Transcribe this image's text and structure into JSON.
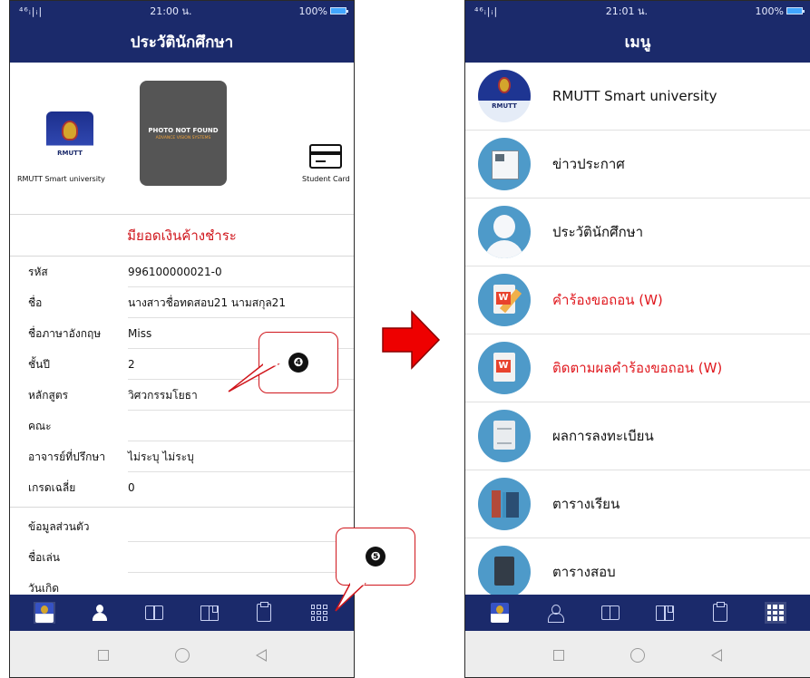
{
  "left": {
    "status": {
      "signal": "⁴⁶ᵢ|ᵢ|",
      "time": "21:00 น.",
      "battery": "100%"
    },
    "title": "ประวัตินักศึกษา",
    "app_caption": "RMUTT Smart university",
    "app_logo_text": "RMUTT",
    "photo_text": "PHOTO NOT FOUND",
    "photo_subtext": "ADVANCE VISION SYSTEMS",
    "card_caption": "Student Card",
    "debt_notice": "มียอดเงินค้างชำระ",
    "rows": [
      {
        "label": "รหัส",
        "value": "996100000021-0"
      },
      {
        "label": "ชื่อ",
        "value": "นางสาวชื่อทดสอบ21 นามสกุล21"
      },
      {
        "label": "ชื่อภาษาอังกฤษ",
        "value": "Miss"
      },
      {
        "label": "ชั้นปี",
        "value": "2"
      },
      {
        "label": "หลักสูตร",
        "value": "วิศวกรรมโยธา"
      },
      {
        "label": "คณะ",
        "value": ""
      },
      {
        "label": "อาจารย์ที่ปรึกษา",
        "value": "ไม่ระบุ ไม่ระบุ"
      },
      {
        "label": "เกรดเฉลี่ย",
        "value": "0"
      }
    ],
    "rows2": [
      {
        "label": "ข้อมูลส่วนตัว",
        "value": ""
      },
      {
        "label": "ชื่อเล่น",
        "value": ""
      },
      {
        "label": "วันเกิด",
        "value": ""
      }
    ]
  },
  "callouts": {
    "c4": "❹",
    "c5": "❺"
  },
  "right": {
    "status": {
      "signal": "⁴⁶ᵢ|ᵢ|",
      "time": "21:01 น.",
      "battery": "100%"
    },
    "title": "เมนู",
    "menu": [
      {
        "label": "RMUTT Smart university",
        "icon": "app-logo-icon",
        "red": false
      },
      {
        "label": "ข่าวประกาศ",
        "icon": "newspaper-icon",
        "red": false
      },
      {
        "label": "ประวัตินักศึกษา",
        "icon": "person-icon",
        "red": false
      },
      {
        "label": "คำร้องขอถอน (W)",
        "icon": "edit-document-icon",
        "red": true
      },
      {
        "label": "ติดตามผลคำร้องขอถอน (W)",
        "icon": "word-document-icon",
        "red": true
      },
      {
        "label": "ผลการลงทะเบียน",
        "icon": "list-document-icon",
        "red": false
      },
      {
        "label": "ตารางเรียน",
        "icon": "books-icon",
        "red": false
      },
      {
        "label": "ตารางสอบ",
        "icon": "book-icon",
        "red": false
      }
    ],
    "menu_logo_text": "RMUTT"
  },
  "colors": {
    "header": "#1b2a6b",
    "accent_red": "#d0161c",
    "menu_icon_bg": "#4e9ac9"
  }
}
